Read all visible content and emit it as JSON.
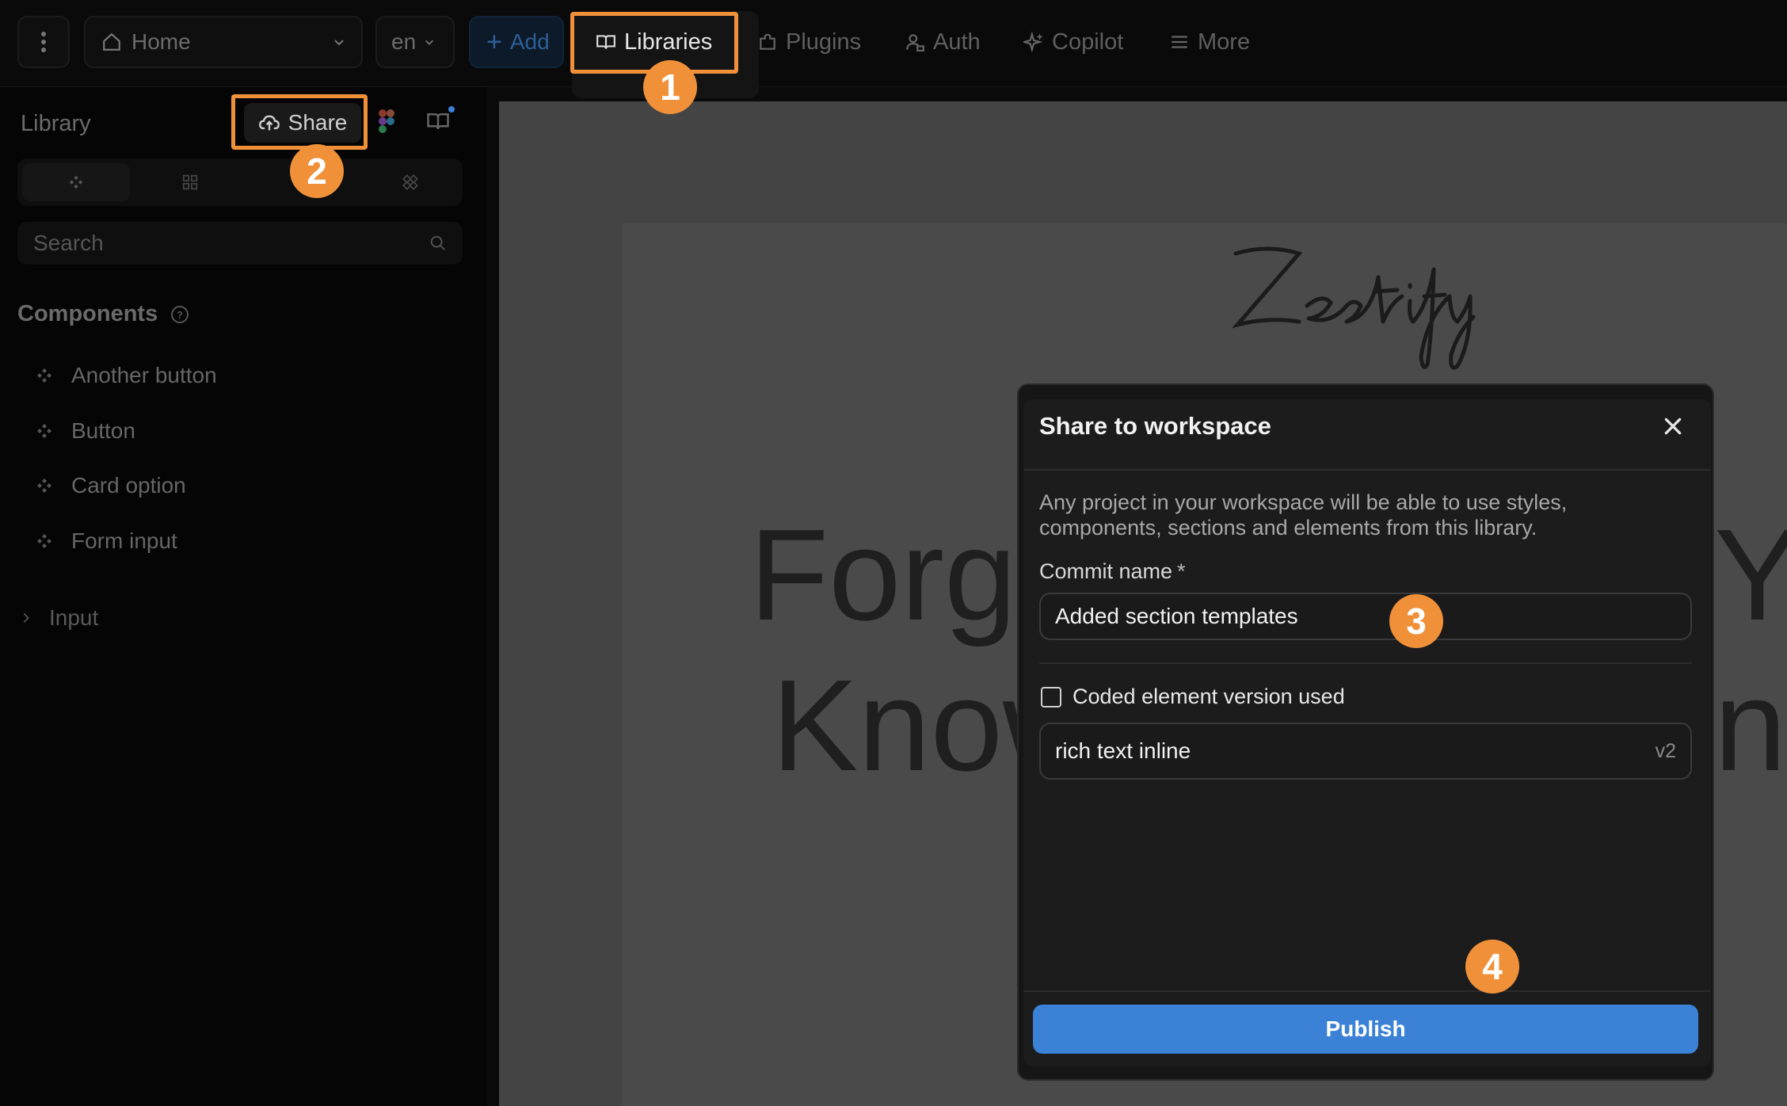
{
  "topbar": {
    "page_select": "Home",
    "locale": "en",
    "tabs": {
      "add": "Add",
      "libraries": "Libraries",
      "plugins": "Plugins",
      "auth": "Auth",
      "copilot": "Copilot",
      "more": "More"
    }
  },
  "sidebar": {
    "title": "Library",
    "share_label": "Share",
    "search_placeholder": "Search",
    "components_heading": "Components",
    "components": [
      "Another button",
      "Button",
      "Card option",
      "Form input"
    ],
    "group_label": "Input"
  },
  "canvas": {
    "logo_text": "Zestify",
    "hero_line1": "Forge",
    "hero_line1_right": "Y",
    "hero_line2": "Know",
    "hero_line2_right": "ng"
  },
  "modal": {
    "title": "Share to workspace",
    "description": "Any project in your workspace will be able to use styles, components, sections and elements from this library.",
    "commit_label": "Commit name",
    "required_mark": "*",
    "commit_value": "Added section templates",
    "checkbox_label": "Coded element version used",
    "element_name": "rich text inline",
    "element_version": "v2",
    "publish_label": "Publish"
  },
  "steps": [
    "1",
    "2",
    "3",
    "4"
  ],
  "colors": {
    "accent_orange": "#f0913a",
    "publish_blue": "#3b82d6"
  }
}
